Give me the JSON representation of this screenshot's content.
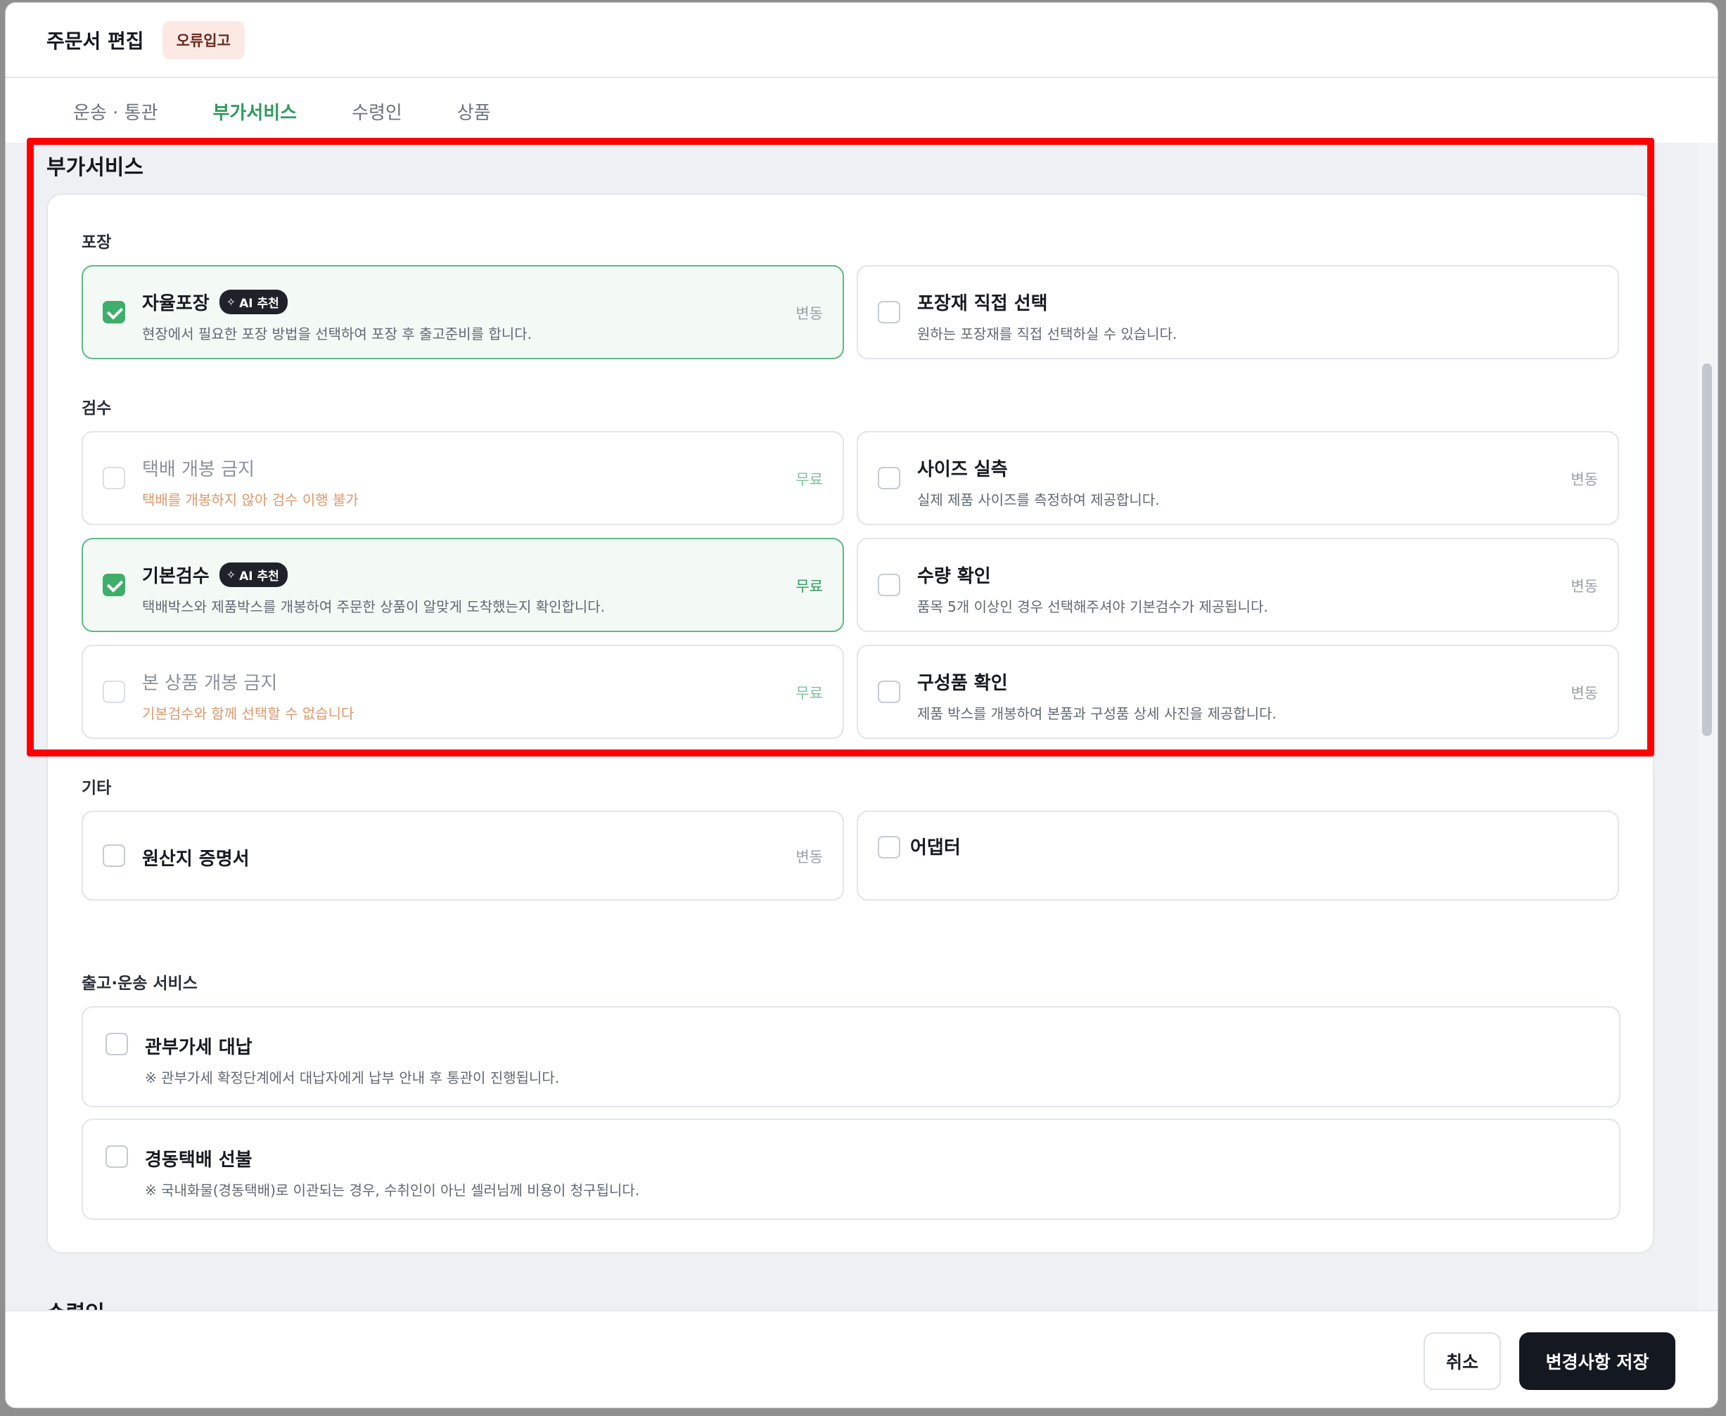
{
  "modal": {
    "title": "주문서 편집",
    "status_badge": "오류입고"
  },
  "tabs": [
    {
      "label": "운송 · 통관",
      "active": false
    },
    {
      "label": "부가서비스",
      "active": true
    },
    {
      "label": "수령인",
      "active": false
    },
    {
      "label": "상품",
      "active": false
    }
  ],
  "section": {
    "title": "부가서비스",
    "next_section_title": "수령인"
  },
  "groups": {
    "packing": {
      "label": "포장",
      "options": [
        {
          "title": "자율포장",
          "ai_badge": "AI 추천",
          "desc": "현장에서 필요한 포장 방법을 선택하여 포장 후 출고준비를 합니다.",
          "price": "변동",
          "checked": true
        },
        {
          "title": "포장재 직접 선택",
          "desc": "원하는 포장재를 직접 선택하실 수 있습니다.",
          "price": "",
          "checked": false
        }
      ]
    },
    "inspection": {
      "label": "검수",
      "options": [
        {
          "title": "택배 개봉 금지",
          "desc": "택배를 개봉하지 않아 검수 이행 불가",
          "price": "무료",
          "checked": false,
          "disabled": true
        },
        {
          "title": "사이즈 실측",
          "desc": "실제 제품 사이즈를 측정하여 제공합니다.",
          "price": "변동",
          "checked": false
        },
        {
          "title": "기본검수",
          "ai_badge": "AI 추천",
          "desc": "택배박스와 제품박스를 개봉하여 주문한 상품이 알맞게 도착했는지 확인합니다.",
          "price": "무료",
          "checked": true
        },
        {
          "title": "수량 확인",
          "desc": "품목 5개 이상인 경우 선택해주셔야 기본검수가 제공됩니다.",
          "price": "변동",
          "checked": false
        },
        {
          "title": "본 상품 개봉 금지",
          "desc": "기본검수와 함께 선택할 수 없습니다",
          "price": "무료",
          "checked": false,
          "disabled": true
        },
        {
          "title": "구성품 확인",
          "desc": "제품 박스를 개봉하여 본품과 구성품 상세 사진을 제공합니다.",
          "price": "변동",
          "checked": false
        }
      ]
    },
    "other": {
      "label": "기타",
      "options": [
        {
          "title": "원산지 증명서",
          "price": "변동",
          "checked": false
        },
        {
          "title": "어댑터",
          "price": "",
          "checked": false
        }
      ]
    },
    "shipping": {
      "label": "출고·운송 서비스",
      "options": [
        {
          "title": "관부가세 대납",
          "desc": "※ 관부가세 확정단계에서 대납자에게 납부 안내 후 통관이 진행됩니다.",
          "checked": false
        },
        {
          "title": "경동택배 선불",
          "desc": "※ 국내화물(경동택배)로 이관되는 경우, 수취인이 아닌 셀러님께 비용이 청구됩니다.",
          "checked": false
        }
      ]
    }
  },
  "footer": {
    "cancel_label": "취소",
    "save_label": "변경사항 저장"
  },
  "colors": {
    "accent_green": "#3fae6b",
    "highlight_red": "#ff0000",
    "primary_dark": "#141820",
    "warning_orange": "#e0976a"
  }
}
